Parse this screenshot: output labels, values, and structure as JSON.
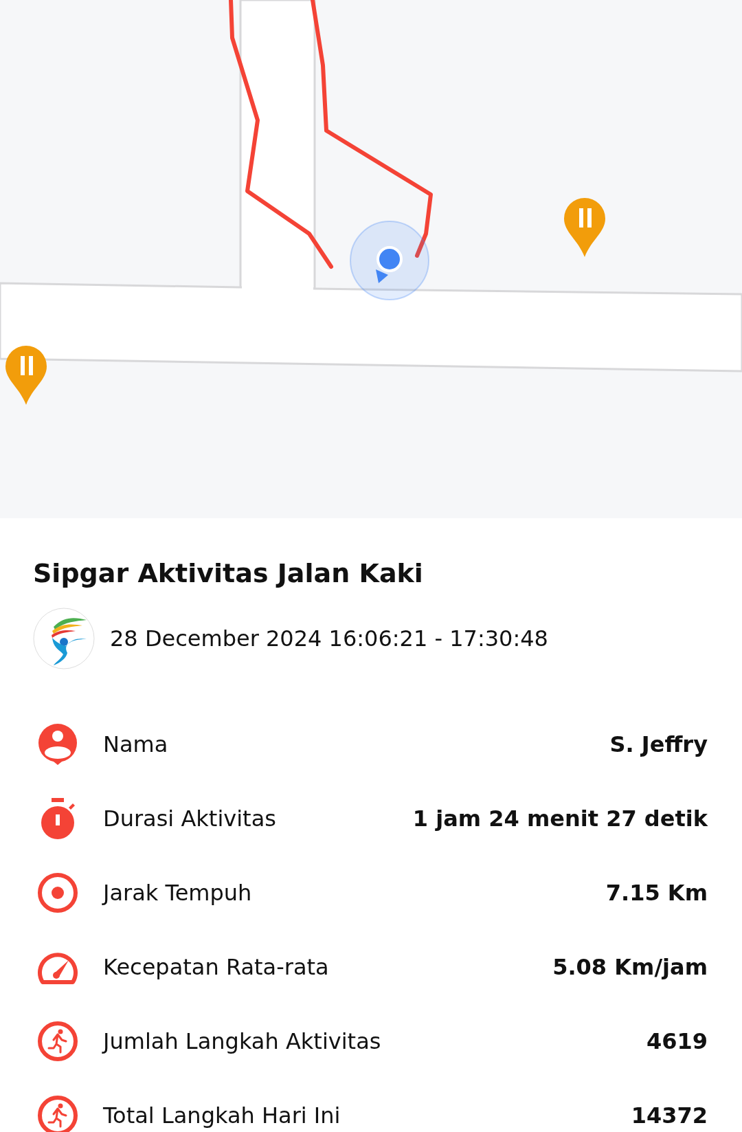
{
  "activity": {
    "title": "Sipgar Aktivitas Jalan Kaki",
    "datetime": "28 December 2024 16:06:21 - 17:30:48"
  },
  "stats": [
    {
      "kind": "person",
      "label": "Nama",
      "value": "S. Jeffry"
    },
    {
      "kind": "timer",
      "label": "Durasi Aktivitas",
      "value": "1 jam 24 menit 27 detik"
    },
    {
      "kind": "target",
      "label": "Jarak Tempuh",
      "value": "7.15 Km"
    },
    {
      "kind": "speed",
      "label": "Kecepatan Rata-rata",
      "value": "5.08 Km/jam"
    },
    {
      "kind": "steps",
      "label": "Jumlah Langkah Aktivitas",
      "value": "4619"
    },
    {
      "kind": "steps",
      "label": "Total Langkah Hari Ini",
      "value": "14372"
    }
  ]
}
